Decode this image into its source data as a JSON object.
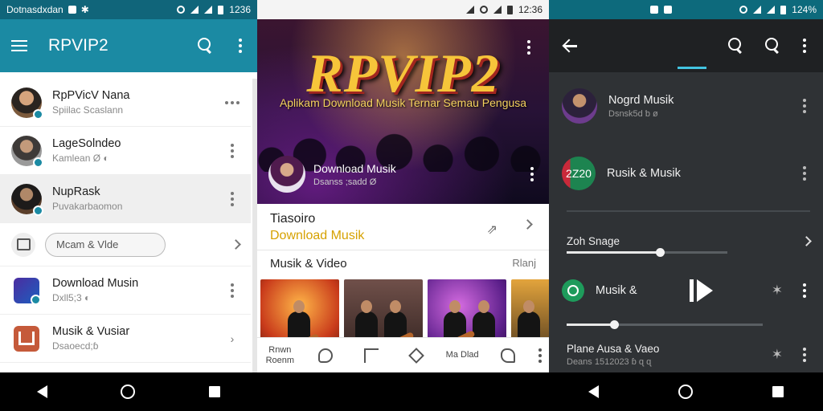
{
  "screen1": {
    "status": {
      "left_text": "Dotnasdxdan",
      "time": "1236"
    },
    "appbar": {
      "title": "RPVIP2"
    },
    "rows": [
      {
        "title": "RpPVicV Nana",
        "subtitle": "Spiilac Scaslann",
        "action": "more-horizontal"
      },
      {
        "title": "LageSolndeo",
        "subtitle": "Kamlean Ø ◐",
        "action": "more-vertical"
      },
      {
        "title": "NupRask",
        "subtitle": "Puvakarbaomon",
        "action": "more-vertical"
      }
    ],
    "pill": {
      "label": "Mcam & Vlde"
    },
    "rows2": [
      {
        "title": "Download Musin",
        "subtitle": "Dxll5;3 ◐"
      },
      {
        "title": "Musik & Vusiar",
        "subtitle": "Dsaoecd;ɓ"
      }
    ]
  },
  "screen2": {
    "status": {
      "time": "12:36"
    },
    "hero": {
      "title": "RPVIP2",
      "subtitle": "Aplikam Download Musik Ternar Semau Pengusa",
      "item_title": "Download Musik",
      "item_subtitle": "Dsanss ;sadd Ø"
    },
    "section": {
      "label": "Tiasoiro",
      "link": "Download Musik"
    },
    "music_video": {
      "heading": "Musik & Video",
      "more": "Rlanj"
    },
    "tabs": [
      {
        "label": "Rnwn Roenm"
      },
      {
        "label": ""
      },
      {
        "label": ""
      },
      {
        "label": ""
      },
      {
        "label": "Ma Dlad"
      },
      {
        "label": ""
      }
    ]
  },
  "screen3": {
    "status": {
      "battery": "124%"
    },
    "rows": [
      {
        "title": "Nogrd Musik",
        "subtitle": "Dsnsk5d ƅ ø"
      },
      {
        "title": "Rusik & Musik",
        "avatar_text": "2Z20"
      }
    ],
    "slider1": {
      "label": "Zoh Snage",
      "value": 0.58
    },
    "player": {
      "title": "Musik &"
    },
    "slider2": {
      "value": 0.24
    },
    "bottom_row": {
      "title": "Plane Ausa & Vaeo",
      "subtitle": "Deans 1512023 ɓ ɋ ɋ"
    }
  },
  "icons": {
    "menu": "hamburger-icon",
    "search": "search-icon",
    "more": "kebab-icon",
    "back": "arrow-left-icon",
    "play": "play-icon",
    "star": "star-icon"
  },
  "colors": {
    "teal_appbar": "#1b8aa3",
    "teal_status": "#10657a",
    "gold_title": "#f6c53a",
    "gold_link": "#d6a100",
    "dark_panel": "#2f3235"
  }
}
